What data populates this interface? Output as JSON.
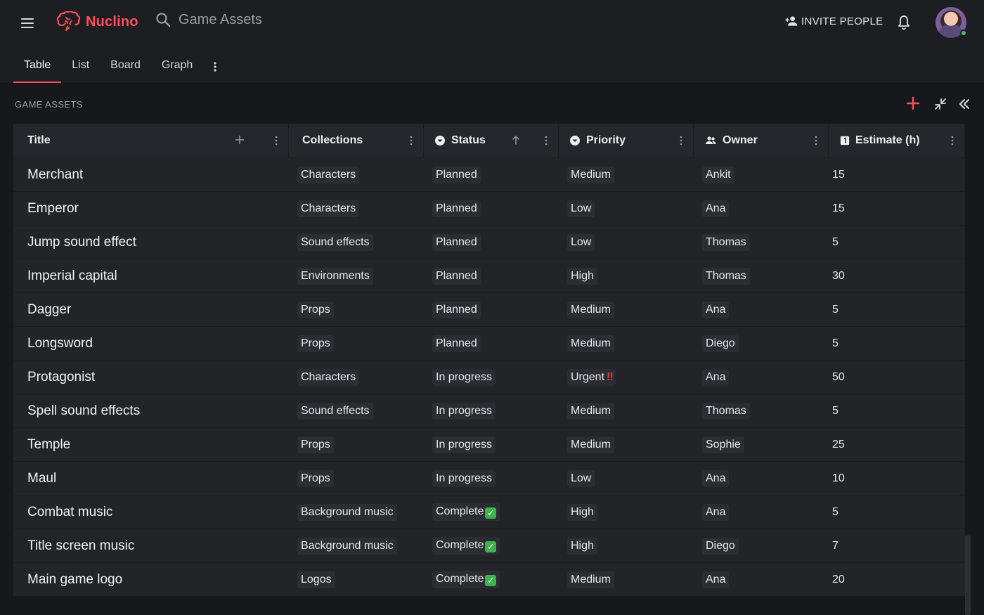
{
  "app": {
    "name": "Nuclino"
  },
  "search": {
    "text": "Game Assets"
  },
  "header": {
    "invite_label": "INVITE PEOPLE"
  },
  "tabs": [
    {
      "label": "Table",
      "active": true
    },
    {
      "label": "List"
    },
    {
      "label": "Board"
    },
    {
      "label": "Graph"
    }
  ],
  "section": {
    "title": "GAME ASSETS"
  },
  "table": {
    "columns": [
      {
        "label": "Title",
        "icon": "none"
      },
      {
        "label": "Collections",
        "icon": "none"
      },
      {
        "label": "Status",
        "icon": "dropdown-circle-icon",
        "sort": "ascending"
      },
      {
        "label": "Priority",
        "icon": "dropdown-circle-icon"
      },
      {
        "label": "Owner",
        "icon": "people-icon"
      },
      {
        "label": "Estimate (h)",
        "icon": "number-icon"
      }
    ],
    "rows": [
      {
        "title": "Merchant",
        "collection": "Characters",
        "status": "Planned",
        "status_emoji": "",
        "priority": "Medium",
        "priority_emoji": "",
        "owner": "Ankit",
        "estimate": "15"
      },
      {
        "title": "Emperor",
        "collection": "Characters",
        "status": "Planned",
        "status_emoji": "",
        "priority": "Low",
        "priority_emoji": "",
        "owner": "Ana",
        "estimate": "15"
      },
      {
        "title": "Jump sound effect",
        "collection": "Sound effects",
        "status": "Planned",
        "status_emoji": "",
        "priority": "Low",
        "priority_emoji": "",
        "owner": "Thomas",
        "estimate": "5"
      },
      {
        "title": "Imperial capital",
        "collection": "Environments",
        "status": "Planned",
        "status_emoji": "",
        "priority": "High",
        "priority_emoji": "",
        "owner": "Thomas",
        "estimate": "30"
      },
      {
        "title": "Dagger",
        "collection": "Props",
        "status": "Planned",
        "status_emoji": "",
        "priority": "Medium",
        "priority_emoji": "",
        "owner": "Ana",
        "estimate": "5"
      },
      {
        "title": "Longsword",
        "collection": "Props",
        "status": "Planned",
        "status_emoji": "",
        "priority": "Medium",
        "priority_emoji": "",
        "owner": "Diego",
        "estimate": "5"
      },
      {
        "title": "Protagonist",
        "collection": "Characters",
        "status": "In progress",
        "status_emoji": "",
        "priority": "Urgent",
        "priority_emoji": "‼",
        "owner": "Ana",
        "estimate": "50"
      },
      {
        "title": "Spell sound effects",
        "collection": "Sound effects",
        "status": "In progress",
        "status_emoji": "",
        "priority": "Medium",
        "priority_emoji": "",
        "owner": "Thomas",
        "estimate": "5"
      },
      {
        "title": "Temple",
        "collection": "Props",
        "status": "In progress",
        "status_emoji": "",
        "priority": "Medium",
        "priority_emoji": "",
        "owner": "Sophie",
        "estimate": "25"
      },
      {
        "title": "Maul",
        "collection": "Props",
        "status": "In progress",
        "status_emoji": "",
        "priority": "Low",
        "priority_emoji": "",
        "owner": "Ana",
        "estimate": "10"
      },
      {
        "title": "Combat music",
        "collection": "Background music",
        "status": "Complete",
        "status_emoji": "✓",
        "priority": "High",
        "priority_emoji": "",
        "owner": "Ana",
        "estimate": "5"
      },
      {
        "title": "Title screen music",
        "collection": "Background music",
        "status": "Complete",
        "status_emoji": "✓",
        "priority": "High",
        "priority_emoji": "",
        "owner": "Diego",
        "estimate": "7"
      },
      {
        "title": "Main game logo",
        "collection": "Logos",
        "status": "Complete",
        "status_emoji": "✓",
        "priority": "Medium",
        "priority_emoji": "",
        "owner": "Ana",
        "estimate": "20"
      }
    ]
  },
  "colors": {
    "accent": "#ff4d5a",
    "background": "#1d1e22",
    "table_row": "#232428",
    "online": "#49c36a"
  }
}
